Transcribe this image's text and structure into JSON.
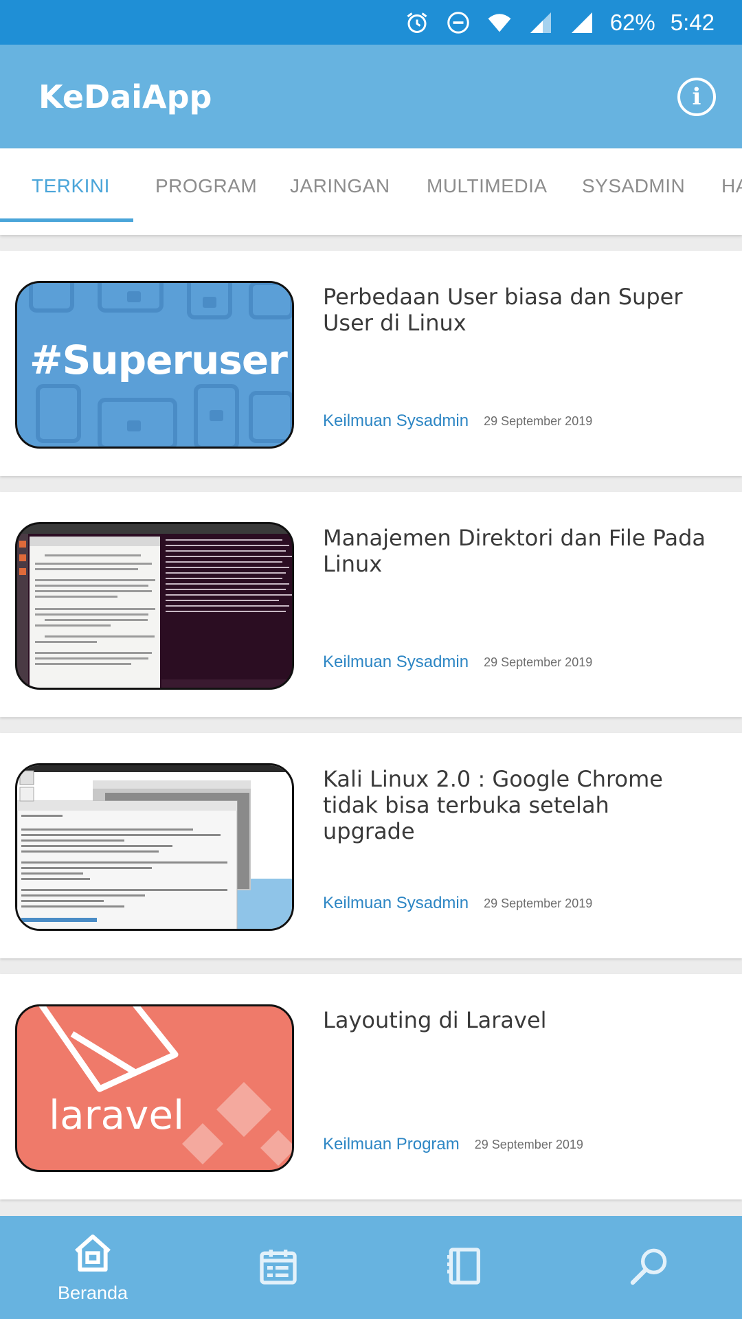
{
  "status_bar": {
    "battery": "62%",
    "time": "5:42",
    "icons": [
      "alarm-icon",
      "do-not-disturb-icon",
      "wifi-icon",
      "signal-icon",
      "signal-icon",
      "battery-icon"
    ]
  },
  "app_bar": {
    "title": "KeDaiApp",
    "info_icon": "info-icon"
  },
  "tabs": [
    {
      "label": "TERKINI",
      "active": true
    },
    {
      "label": "PROGRAM",
      "active": false
    },
    {
      "label": "JARINGAN",
      "active": false
    },
    {
      "label": "MULTIMEDIA",
      "active": false
    },
    {
      "label": "SYSADMIN",
      "active": false
    },
    {
      "label": "HA",
      "active": false
    }
  ],
  "articles": [
    {
      "title": "Perbedaan User biasa dan Super User di Linux",
      "category": "Keilmuan Sysadmin",
      "date": "29 September 2019",
      "thumb_text": "#Superuser"
    },
    {
      "title": "Manajemen Direktori dan File Pada Linux",
      "category": "Keilmuan Sysadmin",
      "date": "29 September 2019"
    },
    {
      "title": "Kali Linux 2.0 : Google Chrome tidak bisa terbuka setelah upgrade",
      "category": "Keilmuan Sysadmin",
      "date": "29 September 2019"
    },
    {
      "title": "Layouting di Laravel",
      "category": "Keilmuan Program",
      "date": "29 September 2019",
      "thumb_text": "laravel"
    }
  ],
  "bottom_nav": [
    {
      "label": "Beranda",
      "icon": "home-icon",
      "active": true
    },
    {
      "label": "",
      "icon": "calendar-icon",
      "active": false
    },
    {
      "label": "",
      "icon": "notebook-icon",
      "active": false
    },
    {
      "label": "",
      "icon": "search-icon",
      "active": false
    }
  ],
  "colors": {
    "status_bar": "#1f8fd6",
    "app_bar": "#67b3e0",
    "tab_active": "#4aa5d9",
    "category_link": "#2d86c4"
  }
}
